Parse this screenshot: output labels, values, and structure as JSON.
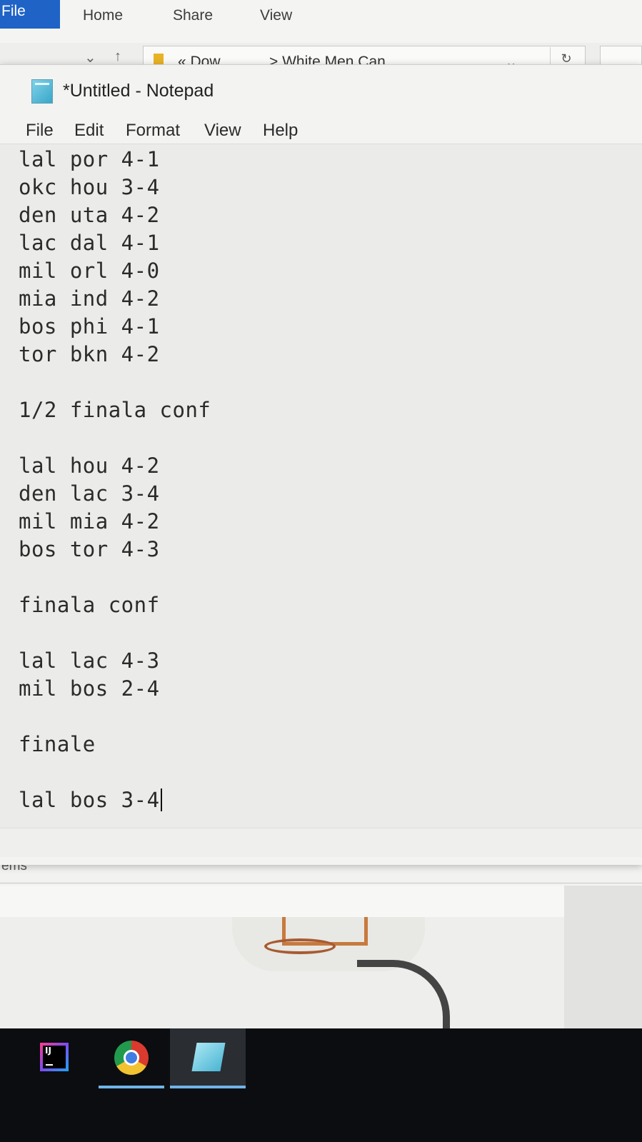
{
  "explorer": {
    "ribbon_tabs": [
      "File",
      "Home",
      "Share",
      "View"
    ],
    "address": {
      "crumb1": "« Dow",
      "crumb2": "> White Men Can",
      "dropdown": "⌄",
      "refresh": "↻"
    },
    "status_text": "ems"
  },
  "notepad": {
    "title": "*Untitled - Notepad",
    "menu": [
      "File",
      "Edit",
      "Format",
      "View",
      "Help"
    ],
    "lines": [
      "lal por 4-1",
      "okc hou 3-4",
      "den uta 4-2",
      "lac dal 4-1",
      "mil orl 4-0",
      "mia ind 4-2",
      "bos phi 4-1",
      "tor bkn 4-2",
      "",
      "1/2 finala conf",
      "",
      "lal hou 4-2",
      "den lac 3-4",
      "mil mia 4-2",
      "bos tor 4-3",
      "",
      "finala conf",
      "",
      "lal lac 4-3",
      "mil bos 2-4",
      "",
      "finale",
      "",
      "lal bos 3-4"
    ]
  },
  "taskbar": {
    "items": [
      {
        "name": "intellij-idea",
        "icon": "intellij-icon",
        "active": false
      },
      {
        "name": "google-chrome",
        "icon": "chrome-icon",
        "active": false
      },
      {
        "name": "notepad",
        "icon": "notepad-icon",
        "active": true
      }
    ],
    "ij_label": "IJ"
  },
  "colors": {
    "accent_blue": "#1f63c6",
    "taskbar_bg": "#0b0d10",
    "task_underline": "#6fb3e8"
  }
}
